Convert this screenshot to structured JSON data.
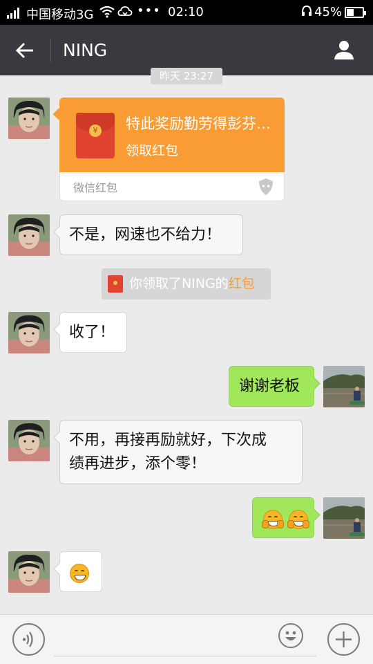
{
  "status_bar": {
    "carrier": "中国移动3G",
    "dots": "•••",
    "time": "02:10",
    "battery": "45%",
    "battery_level": 0.45,
    "icons": [
      "signal-icon",
      "wifi-icon",
      "cloud-icon",
      "headset-icon",
      "battery-icon"
    ]
  },
  "header": {
    "title": "NING",
    "back_icon": "arrow-left-icon",
    "profile_icon": "person-icon"
  },
  "timestamp": "昨天 23:27",
  "red_packet": {
    "title": "特此奖励勤劳得彭芬…",
    "action": "领取红包",
    "label": "微信红包",
    "coin": "¥"
  },
  "messages": [
    {
      "side": "left",
      "text": "不是，网速也不给力！"
    },
    {
      "side": "left",
      "text": "收了！"
    },
    {
      "side": "right",
      "text": "谢谢老板"
    },
    {
      "side": "left",
      "line1": "不用，再接再励就好，下次成",
      "line2": "绩再进步，添个零！"
    },
    {
      "side": "right",
      "emoji": "fist-bump-emoji"
    },
    {
      "side": "left",
      "emoji": "grin-emoji"
    }
  ],
  "notice": {
    "text": "你领取了NING的",
    "link": "红包"
  },
  "input_bar": {
    "voice_icon": "voice-icon",
    "emoji_icon": "smiley-icon",
    "more_icon": "plus-icon"
  },
  "colors": {
    "header_bg": "#393a3f",
    "chat_bg": "#ebebeb",
    "packet_orange": "#f99c34",
    "bubble_green": "#a0e75a"
  }
}
